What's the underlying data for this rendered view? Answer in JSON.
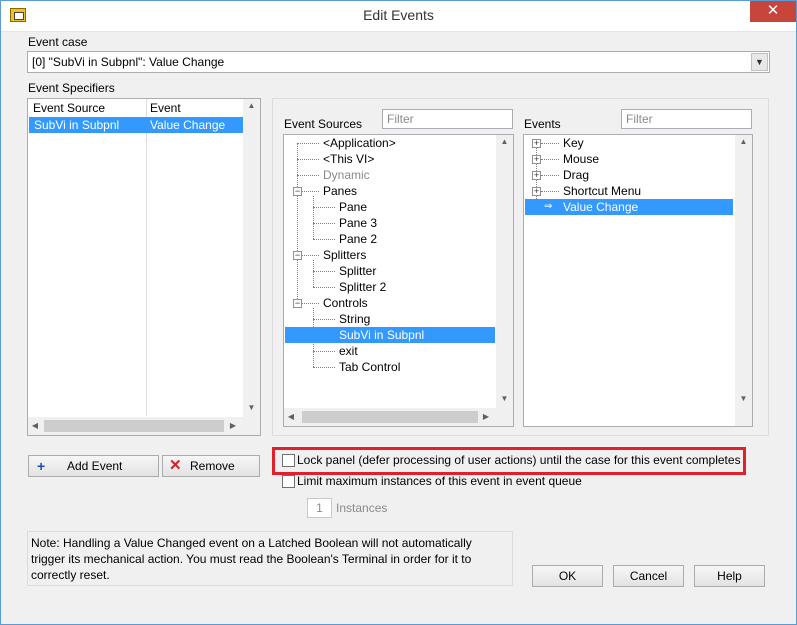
{
  "window": {
    "title": "Edit Events",
    "close_glyph": "✕"
  },
  "event_case": {
    "label": "Event case",
    "value": "[0] \"SubVi in Subpnl\": Value Change"
  },
  "event_specifiers": {
    "label": "Event Specifiers",
    "columns": [
      "Event Source",
      "Event"
    ],
    "rows": [
      {
        "source": "SubVi in Subpnl",
        "event": "Value Change"
      }
    ]
  },
  "event_sources": {
    "label": "Event Sources",
    "filter_placeholder": "Filter",
    "items": [
      "<Application>",
      "<This VI>",
      "Dynamic",
      "Panes",
      "Pane",
      "Pane 3",
      "Pane 2",
      "Splitters",
      "Splitter",
      "Splitter 2",
      "Controls",
      "String",
      "SubVi in Subpnl",
      "exit",
      "Tab Control"
    ],
    "selected": "SubVi in Subpnl"
  },
  "events": {
    "label": "Events",
    "filter_placeholder": "Filter",
    "items": [
      "Key",
      "Mouse",
      "Drag",
      "Shortcut Menu",
      "Value Change"
    ],
    "selected": "Value Change"
  },
  "buttons": {
    "add_event": "Add Event",
    "remove": "Remove",
    "ok": "OK",
    "cancel": "Cancel",
    "help": "Help"
  },
  "options": {
    "lock_panel": "Lock panel (defer processing of user actions) until the case for this event completes",
    "lock_panel_checked": false,
    "limit_instances": "Limit maximum instances of this event in event queue",
    "limit_instances_checked": false,
    "instances_value": "1",
    "instances_label": "Instances"
  },
  "note": "Note:  Handling a Value Changed event on a Latched Boolean will not automatically trigger its mechanical action. You must read the Boolean's Terminal in order for it to correctly reset.",
  "colors": {
    "selection": "#3399ff",
    "highlight_box": "#e0202a",
    "close_button": "#c7453b"
  }
}
